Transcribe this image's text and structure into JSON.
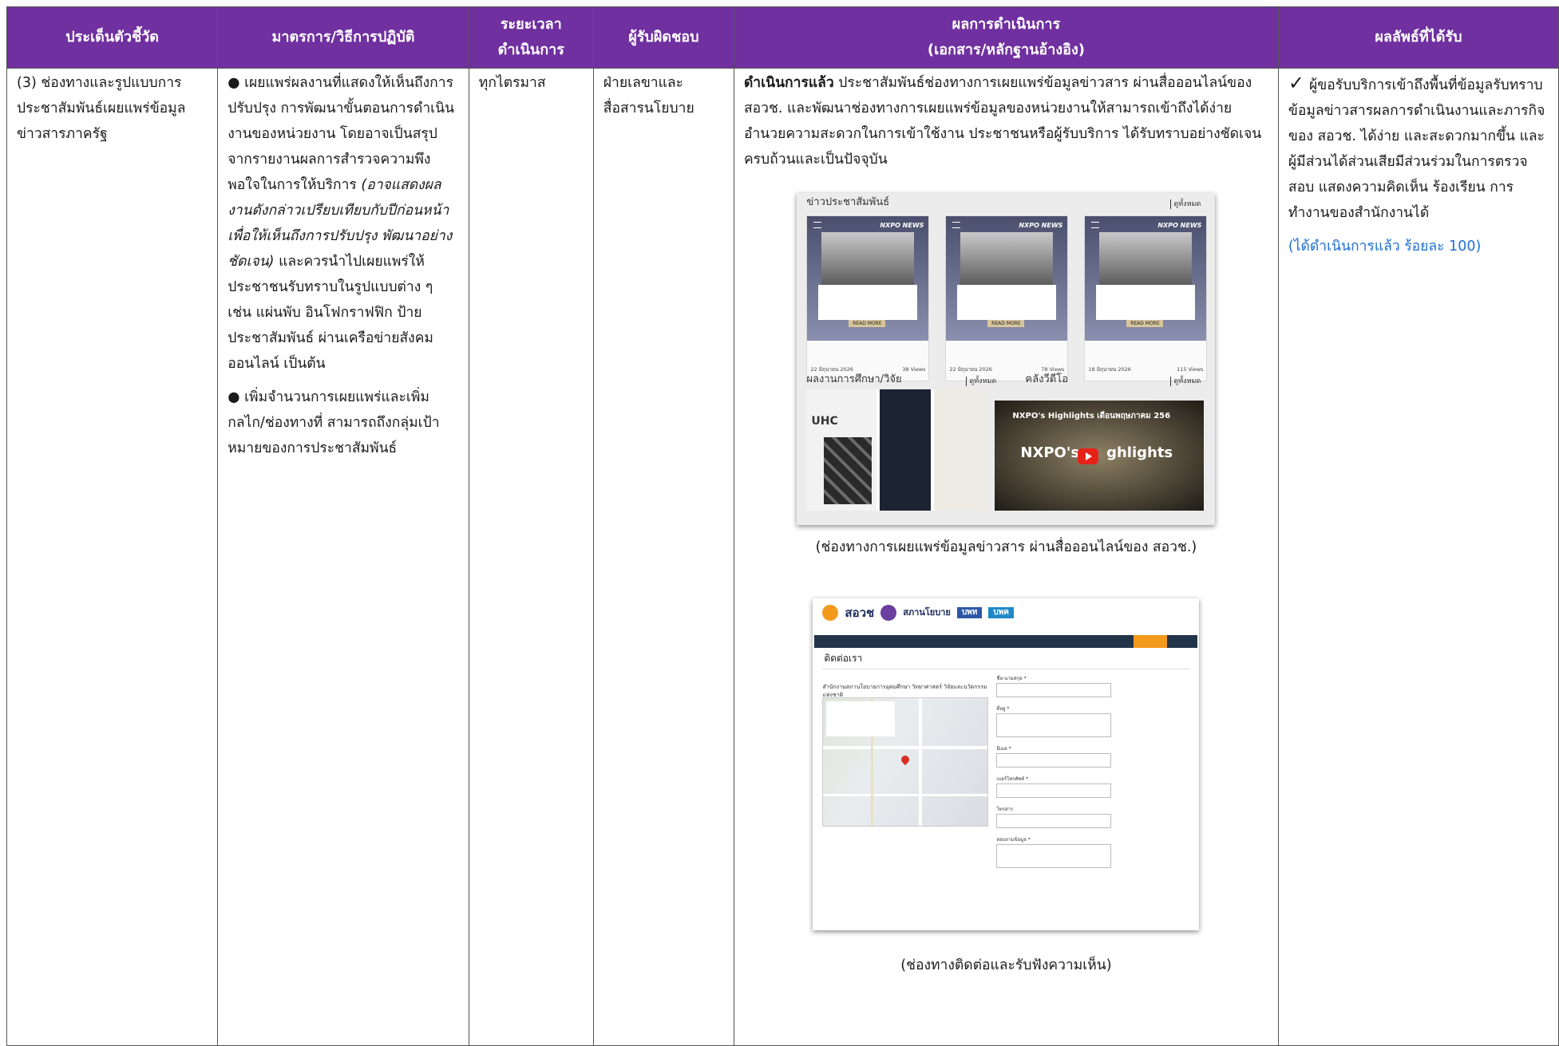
{
  "table": {
    "headers": {
      "indicator": "ประเด็นตัวชี้วัด",
      "measures": "มาตรการ/วิธีการปฏิบัติ",
      "period_line1": "ระยะเวลา",
      "period_line2": "ดำเนินการ",
      "responsible": "ผู้รับผิดชอบ",
      "results_line1": "ผลการดำเนินการ",
      "results_line2": "(เอกสาร/หลักฐานอ้างอิง)",
      "outcome": "ผลลัพธ์ที่ได้รับ"
    },
    "row": {
      "indicator": "(3) ช่องทางและรูปแบบการประชาสัมพันธ์เผยแพร่ข้อมูลข่าวสารภาครัฐ",
      "measure1_bullet": "●",
      "measure1_text": " เผยแพร่ผลงานที่แสดงให้เห็นถึงการปรับปรุง การพัฒนาขั้นตอนการดำเนินงานของหน่วยงาน โดยอาจเป็นสรุปจากรายงานผลการสำรวจความพึงพอใจในการให้บริการ ",
      "measure1_italic": "(อาจแสดงผลงานดังกล่าวเปรียบเทียบกับปีก่อนหน้า เพื่อให้เห็นถึงการปรับปรุง พัฒนาอย่างชัดเจน)",
      "measure1_tail": " และควรนำไปเผยแพร่ให้ประชาชนรับทราบในรูปแบบต่าง ๆ เช่น แผ่นพับ อินโฟกราฟฟิก ป้ายประชาสัมพันธ์ ผ่านเครือข่ายสังคมออนไลน์ เป็นต้น",
      "measure2_bullet": "●",
      "measure2_text": " เพิ่มจำนวนการเผยแพร่และเพิ่มกลไก/ช่องทางที่ สามารถถึงกลุ่มเป้าหมายของการประชาสัมพันธ์",
      "period": "ทุกไตรมาส",
      "responsible": "ฝ่ายเลขาและสื่อสารนโยบาย",
      "result_bold": "ดำเนินการแล้ว",
      "result_text": " ประชาสัมพันธ์ช่องทางการเผยแพร่ข้อมูลข่าวสาร ผ่านสื่อออนไลน์ของ สอวช.  และพัฒนาช่องทางการเผยแพร่ข้อมูลของหน่วยงานให้สามารถเข้าถึงได้ง่าย อำนวยความสะดวกในการเข้าใช้งาน ประชาชนหรือผู้รับบริการ ได้รับทราบอย่างชัดเจน ครบถ้วนและเป็นปัจจุบัน",
      "caption1": "(ช่องทางการเผยแพร่ข้อมูลข่าวสาร ผ่านสื่อออนไลน์ของ สอวช.)",
      "caption2": "(ช่องทางติดต่อและรับฟังความเห็น)",
      "outcome_check": "✓",
      "outcome_text": "ผู้ขอรับบริการเข้าถึงพื้นที่ข้อมูลรับทราบข้อมูลข่าวสารผลการดำเนินงานและภารกิจของ สอวช. ได้ง่าย และสะดวกมากขึ้น และผู้มีส่วนได้ส่วนเสียมีส่วนร่วมในการตรวจสอบ แสดงความคิดเห็น ร้องเรียน การทำงานของสำนักงานได้",
      "outcome_progress": "(ได้ดำเนินการแล้ว ร้อยละ 100)"
    }
  },
  "figure1": {
    "section_news": "ข่าวประชาสัมพันธ์",
    "see_all": "ดูทั้งหมด",
    "brand": "NXPO NEWS",
    "read_more": "READ MORE",
    "cards": [
      {
        "date": "22 มิถุนายน 2026",
        "views": "38 Views"
      },
      {
        "date": "22 มิถุนายน 2026",
        "views": "78 Views"
      },
      {
        "date": "18 มิถุนายน 2026",
        "views": "115 Views"
      }
    ],
    "section_research": "ผลงานการศึกษา/วิจัย",
    "section_video": "คลังวีดีโอ",
    "video_title": "NXPO's Highlights เดือนพฤษภาคม 256",
    "video_big_left": "NXPO's",
    "video_big_right": "ghlights",
    "uhc": "UHC"
  },
  "figure2": {
    "logo": "สอวช",
    "logo2": "สภานโยบาย",
    "logo3": "บพท",
    "logo4": "บพค",
    "page_heading": "ติดต่อเรา",
    "map_heading": "สำนักงานสภานโยบายการอุดมศึกษา วิทยาศาสตร์ วิจัยและนวัตกรรมแห่งชาติ",
    "form_labels": [
      "ชื่อ-นามสกุล *",
      "ที่อยู่ *",
      "อีเมล *",
      "เบอร์โทรศัพท์ *",
      "โทรสาร",
      "สอบถามข้อมูล *"
    ]
  }
}
